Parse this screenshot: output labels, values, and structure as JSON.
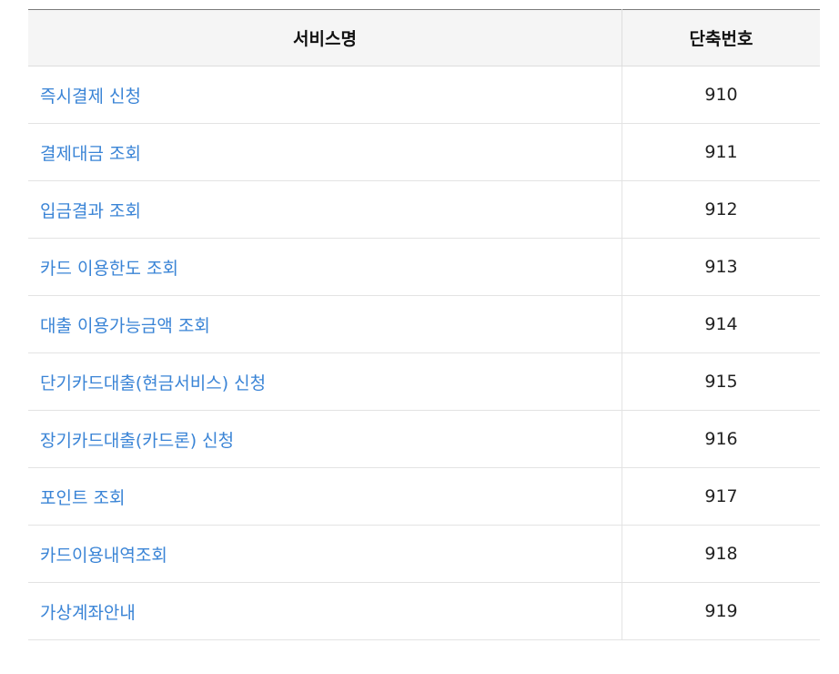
{
  "table": {
    "headers": {
      "service_name": "서비스명",
      "short_code": "단축번호"
    },
    "rows": [
      {
        "service": "즉시결제 신청",
        "code": "910"
      },
      {
        "service": "결제대금 조회",
        "code": "911"
      },
      {
        "service": "입금결과 조회",
        "code": "912"
      },
      {
        "service": "카드 이용한도 조회",
        "code": "913"
      },
      {
        "service": "대출 이용가능금액 조회",
        "code": "914"
      },
      {
        "service": "단기카드대출(현금서비스) 신청",
        "code": "915"
      },
      {
        "service": "장기카드대출(카드론) 신청",
        "code": "916"
      },
      {
        "service": "포인트 조회",
        "code": "917"
      },
      {
        "service": "카드이용내역조회",
        "code": "918"
      },
      {
        "service": "가상계좌안내",
        "code": "919"
      }
    ]
  },
  "colors": {
    "link": "#3a84d6",
    "header_bg": "#f5f5f5",
    "border": "#e3e3e3"
  }
}
